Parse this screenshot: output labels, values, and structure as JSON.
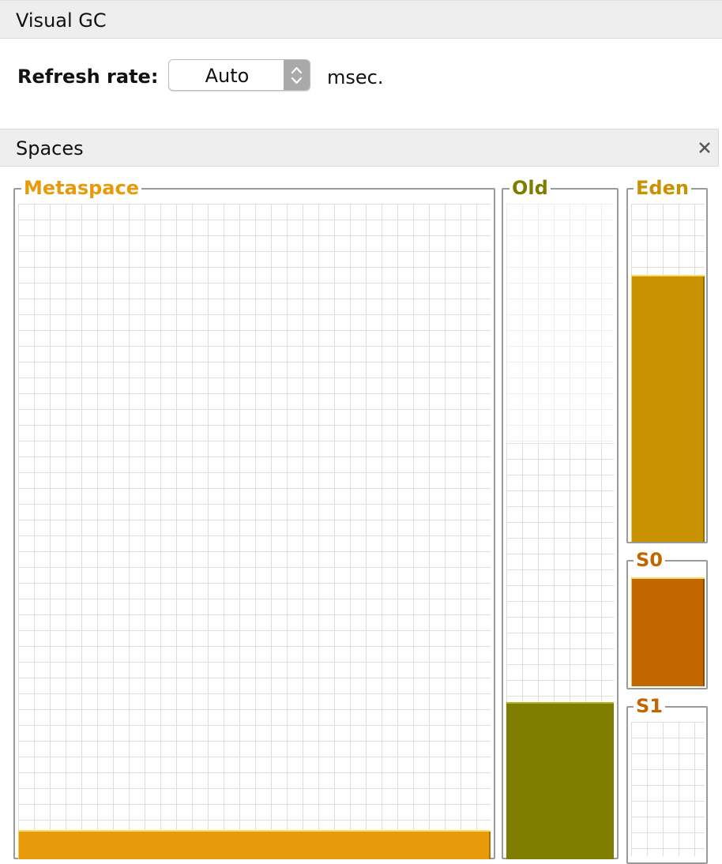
{
  "window": {
    "title": "Visual GC"
  },
  "refresh": {
    "label": "Refresh rate:",
    "value": "Auto",
    "unit": "msec."
  },
  "spaces": {
    "title": "Spaces",
    "panels": {
      "metaspace": {
        "label": "Metaspace",
        "color": "#E89A0A",
        "used_fraction": 0.045
      },
      "old": {
        "label": "Old",
        "color": "#7F7C00",
        "used_fraction": 0.24,
        "capacity_fraction": 0.635
      },
      "eden": {
        "label": "Eden",
        "color": "#C89200",
        "used_fraction": 0.79
      },
      "s0": {
        "label": "S0",
        "color": "#C26600",
        "used_fraction": 1.0
      },
      "s1": {
        "label": "S1",
        "color": "#C26600",
        "used_fraction": 0.0
      }
    }
  }
}
